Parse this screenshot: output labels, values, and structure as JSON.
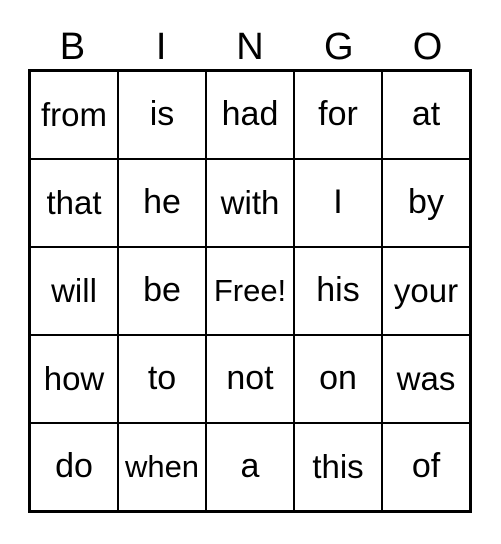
{
  "card": {
    "title": "BINGO",
    "free_space_label": "Free!",
    "colors": {
      "background": "#ffffff",
      "text": "#000000",
      "border": "#000000"
    },
    "header": {
      "letters": [
        "B",
        "I",
        "N",
        "G",
        "O"
      ]
    },
    "grid": {
      "columns": 5,
      "rows": 5,
      "cells": [
        [
          "from",
          "is",
          "had",
          "for",
          "at"
        ],
        [
          "that",
          "he",
          "with",
          "I",
          "by"
        ],
        [
          "will",
          "be",
          "Free!",
          "his",
          "your"
        ],
        [
          "how",
          "to",
          "not",
          "on",
          "was"
        ],
        [
          "do",
          "when",
          "a",
          "this",
          "of"
        ]
      ]
    }
  }
}
